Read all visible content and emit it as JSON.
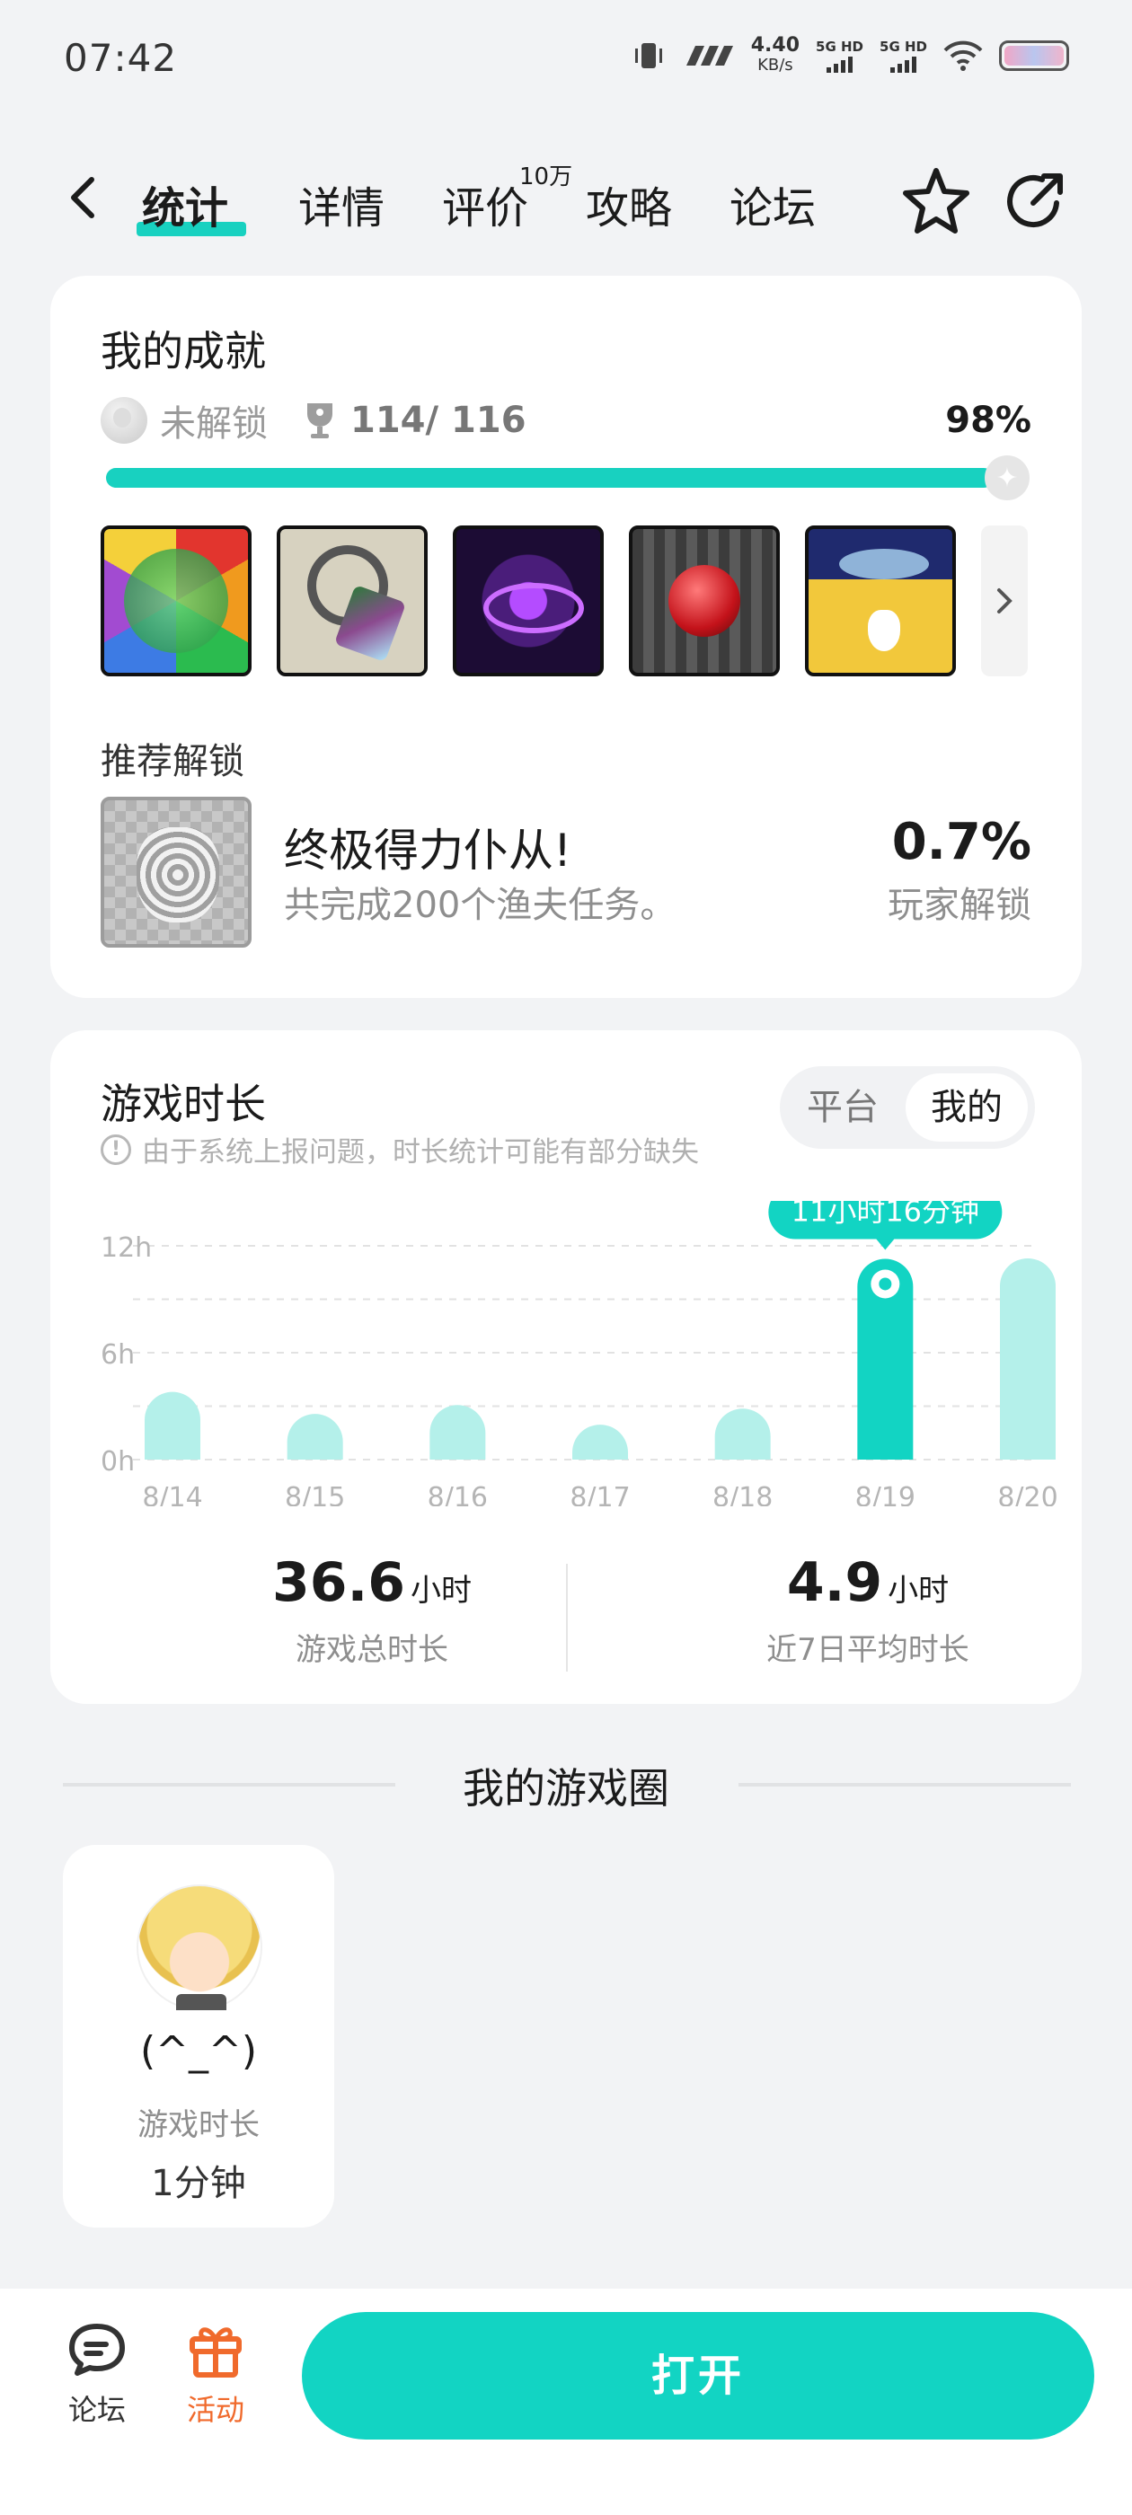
{
  "status_bar": {
    "time": "07:42",
    "net_speed": "4.40",
    "net_unit": "KB/s",
    "sim1": "5G HD",
    "sim2": "5G HD",
    "icons": [
      "vibrate-icon",
      "signal-brand-icon",
      "wifi-icon",
      "battery-icon"
    ]
  },
  "nav": {
    "tabs": [
      {
        "label": "统计",
        "active": true
      },
      {
        "label": "详情",
        "active": false
      },
      {
        "label": "评价",
        "active": false
      },
      {
        "label": "攻略",
        "active": false
      },
      {
        "label": "论坛",
        "active": false
      }
    ],
    "review_badge": "10万",
    "accent": "#18d1c0"
  },
  "achievements": {
    "title": "我的成就",
    "locked_label": "未解锁",
    "count": "114/ 116",
    "percent_text": "98%",
    "progress": 0.98,
    "recommend_title": "推荐解锁",
    "recommend": {
      "name": "终极得力仆从!",
      "description": "共完成200个渔夫任务。",
      "percent": "0.7%",
      "percent_label": "玩家解锁"
    }
  },
  "playtime": {
    "title": "游戏时长",
    "note": "由于系统上报问题，时长统计可能有部分缺失",
    "segments": {
      "platform": "平台",
      "mine": "我的"
    },
    "tooltip": "11小时16分钟",
    "total_value": "36.6",
    "total_unit": "小时",
    "total_label": "游戏总时长",
    "avg_value": "4.9",
    "avg_unit": "小时",
    "avg_label": "近7日平均时长"
  },
  "chart_data": {
    "type": "bar",
    "categories": [
      "8/14",
      "8/15",
      "8/16",
      "8/17",
      "8/18",
      "8/19",
      "8/20"
    ],
    "values": [
      3.8,
      2.0,
      3.0,
      0.8,
      2.6,
      11.27,
      11.3
    ],
    "highlight_index": 5,
    "yticks": [
      "12h",
      "6h",
      "0h"
    ],
    "ylim": [
      0,
      12
    ],
    "grid": true,
    "colors": {
      "bar": "#b4f0ea",
      "highlight": "#12d4c3",
      "grid": "#e2e2e2",
      "tick": "#b5b5b5"
    }
  },
  "game_circle": {
    "title": "我的游戏圈",
    "friend": {
      "name": "(^_^)",
      "label": "游戏时长",
      "value": "1分钟"
    }
  },
  "bottom_bar": {
    "forum_label": "论坛",
    "activity_label": "活动",
    "open_label": "打开",
    "activity_color": "#f06a2c"
  }
}
